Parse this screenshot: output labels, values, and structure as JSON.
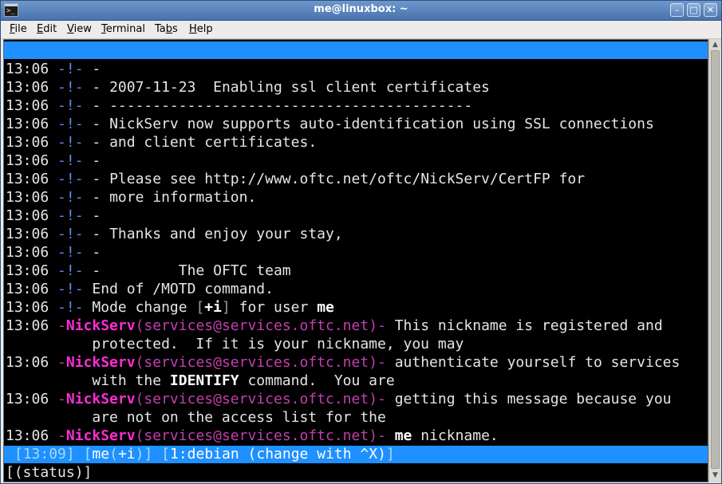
{
  "window": {
    "title": "me@linuxbox: ~",
    "buttons": {
      "minimize": "–",
      "maximize": "□",
      "close": "✕"
    },
    "icon": "terminal-icon"
  },
  "menubar": {
    "items": [
      {
        "first": "F",
        "rest": "ile"
      },
      {
        "first": "E",
        "rest": "dit"
      },
      {
        "first": "V",
        "rest": "iew"
      },
      {
        "first": "T",
        "rest": "erminal"
      },
      {
        "pre": "Ta",
        "first": "b",
        "rest": "s"
      },
      {
        "first": "H",
        "rest": "elp"
      }
    ]
  },
  "terminal": {
    "ts": "13:06",
    "mark": "-!-",
    "motd": [
      "-",
      "- 2007-11-23  Enabling ssl client certificates",
      "- ------------------------------------------",
      "- NickServ now supports auto-identification using SSL connections",
      "- and client certificates.",
      "-",
      "- Please see http://www.oftc.net/oftc/NickServ/CertFP for",
      "- more information.",
      "-",
      "- Thanks and enjoy your stay,",
      "-",
      "-         The OFTC team",
      "End of /MOTD command."
    ],
    "mode_line": {
      "prefix": "Mode change ",
      "lb": "[",
      "mode": "+i",
      "rb": "]",
      "mid": " for user ",
      "user": "me"
    },
    "notices": [
      {
        "lead": "-",
        "nick": "NickServ",
        "open": "(",
        "host": "services@services.oftc.net",
        "close": ")-",
        "text": " This nickname is registered and",
        "cont": "protected.  If it is your nickname, you may"
      },
      {
        "lead": "-",
        "nick": "NickServ",
        "open": "(",
        "host": "services@services.oftc.net",
        "close": ")-",
        "text": " authenticate yourself to services",
        "cont_pre": "with the ",
        "cont_bold": "IDENTIFY",
        "cont_post": " command.  You are"
      },
      {
        "lead": "-",
        "nick": "NickServ",
        "open": "(",
        "host": "services@services.oftc.net",
        "close": ")-",
        "text": " getting this message because you",
        "cont": "are not on the access list for the"
      },
      {
        "lead": "-",
        "nick": "NickServ",
        "open": "(",
        "host": "services@services.oftc.net",
        "close": ")-",
        "text_bold": " me",
        "text_post": " nickname."
      }
    ],
    "statusbar": {
      "lb1": "[",
      "time": "13:09",
      "rb1": "]",
      "lb2": "[",
      "nick": "me",
      "mode_open": "(",
      "mode": "+i",
      "mode_close": ")",
      "rb2": "]",
      "lb3": "[",
      "window": "1:debian (change with ^X)",
      "rb3": "]"
    },
    "prompt": "[(status)]"
  }
}
